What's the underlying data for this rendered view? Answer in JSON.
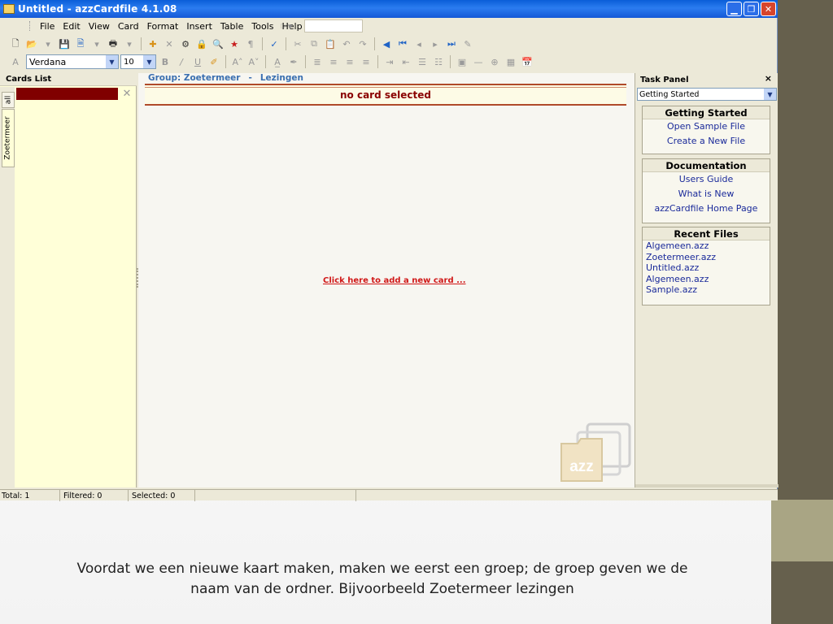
{
  "window": {
    "title": "Untitled - azzCardfile 4.1.08",
    "minimize_icon": "minimize-icon",
    "restore_icon": "restore-icon",
    "close_icon": "close-icon"
  },
  "menu": {
    "items": [
      "File",
      "Edit",
      "View",
      "Card",
      "Format",
      "Insert",
      "Table",
      "Tools",
      "Help"
    ]
  },
  "toolbar2": {
    "font_name": "Verdana",
    "font_size": "10"
  },
  "cards_list": {
    "header": "Cards List",
    "tabs": [
      "all",
      "Zoetermeer"
    ]
  },
  "main": {
    "group_label": "Group: Zoetermeer",
    "separator": "-",
    "group_name": "Lezingen",
    "no_card_text": "no card selected",
    "add_card_link": "Click here to add a new card ..."
  },
  "task_panel": {
    "header": "Task Panel",
    "close_glyph": "×",
    "selected_option": "Getting Started",
    "getting_started": {
      "title": "Getting Started",
      "links": [
        "Open Sample File",
        "Create a New File"
      ]
    },
    "documentation": {
      "title": "Documentation",
      "links": [
        "Users Guide",
        "What is New",
        "azzCardfile Home Page"
      ]
    },
    "recent_files": {
      "title": "Recent Files",
      "files": [
        "Algemeen.azz",
        "Zoetermeer.azz",
        "Untitled.azz",
        "Algemeen.azz",
        "Sample.azz"
      ]
    }
  },
  "statusbar": {
    "total": "Total: 1",
    "filtered": "Filtered: 0",
    "selected": "Selected: 0"
  },
  "logo_text": "azz",
  "caption": {
    "line1": "Voordat we een nieuwe kaart maken, maken we eerst een groep; de groep geven we de",
    "line2": "naam van de ordner. Bijvoorbeeld Zoetermeer lezingen"
  },
  "colors": {
    "titlebar": "#1458d6",
    "card_selected": "#800000",
    "link_red": "#d01818",
    "group_blue": "#3a6fb0",
    "side_band": "#66604d",
    "side_accent": "#a9a584"
  }
}
